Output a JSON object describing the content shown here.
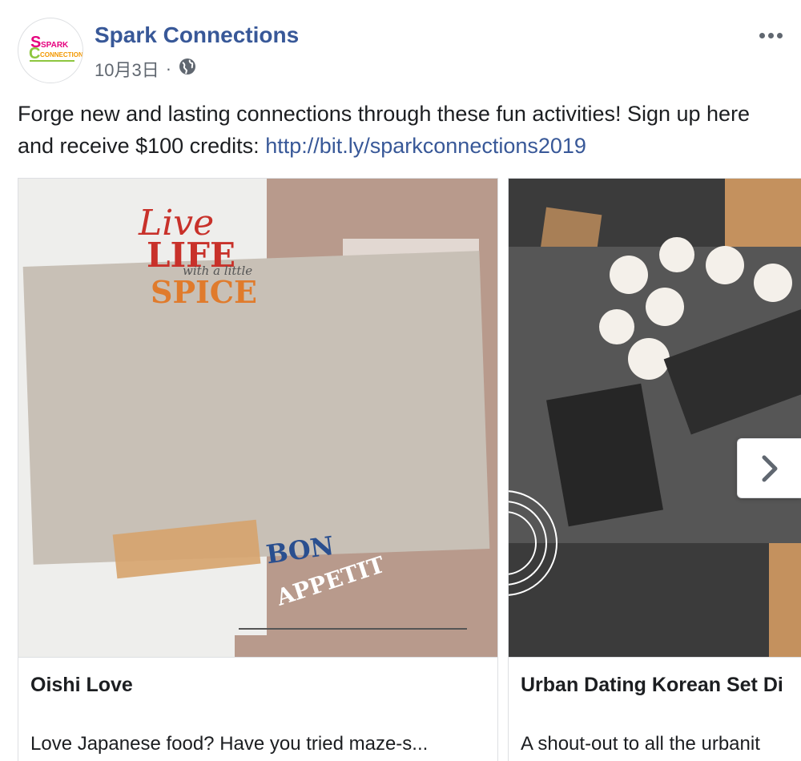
{
  "post": {
    "author_name": "Spark Connections",
    "date": "10月3日",
    "separator": "·",
    "privacy_icon": "globe-icon",
    "more_icon": "more-dots-icon",
    "text": "Forge new and lasting connections through these fun activities! Sign up here and receive $100 credits: ",
    "link": "http://bit.ly/sparkconnections2019"
  },
  "avatar": {
    "logo_text_top": "SPARK",
    "logo_text_bottom": "CONNECTIONS"
  },
  "carousel": {
    "cards": [
      {
        "title": "Oishi Love",
        "description": "Love Japanese food? Have you tried maze-s...",
        "image_text_1": "Live",
        "image_text_2": "LIFE",
        "image_text_3": "with a little",
        "image_text_4": "SPICE",
        "image_text_5": "BON",
        "image_text_6": "APPETIT"
      },
      {
        "title": "Urban Dating Korean Set Di",
        "description": "A shout-out to all the urbanit"
      }
    ],
    "next_icon": "chevron-right-icon"
  },
  "colors": {
    "link": "#385898",
    "text": "#1c1e21",
    "meta": "#606770"
  }
}
